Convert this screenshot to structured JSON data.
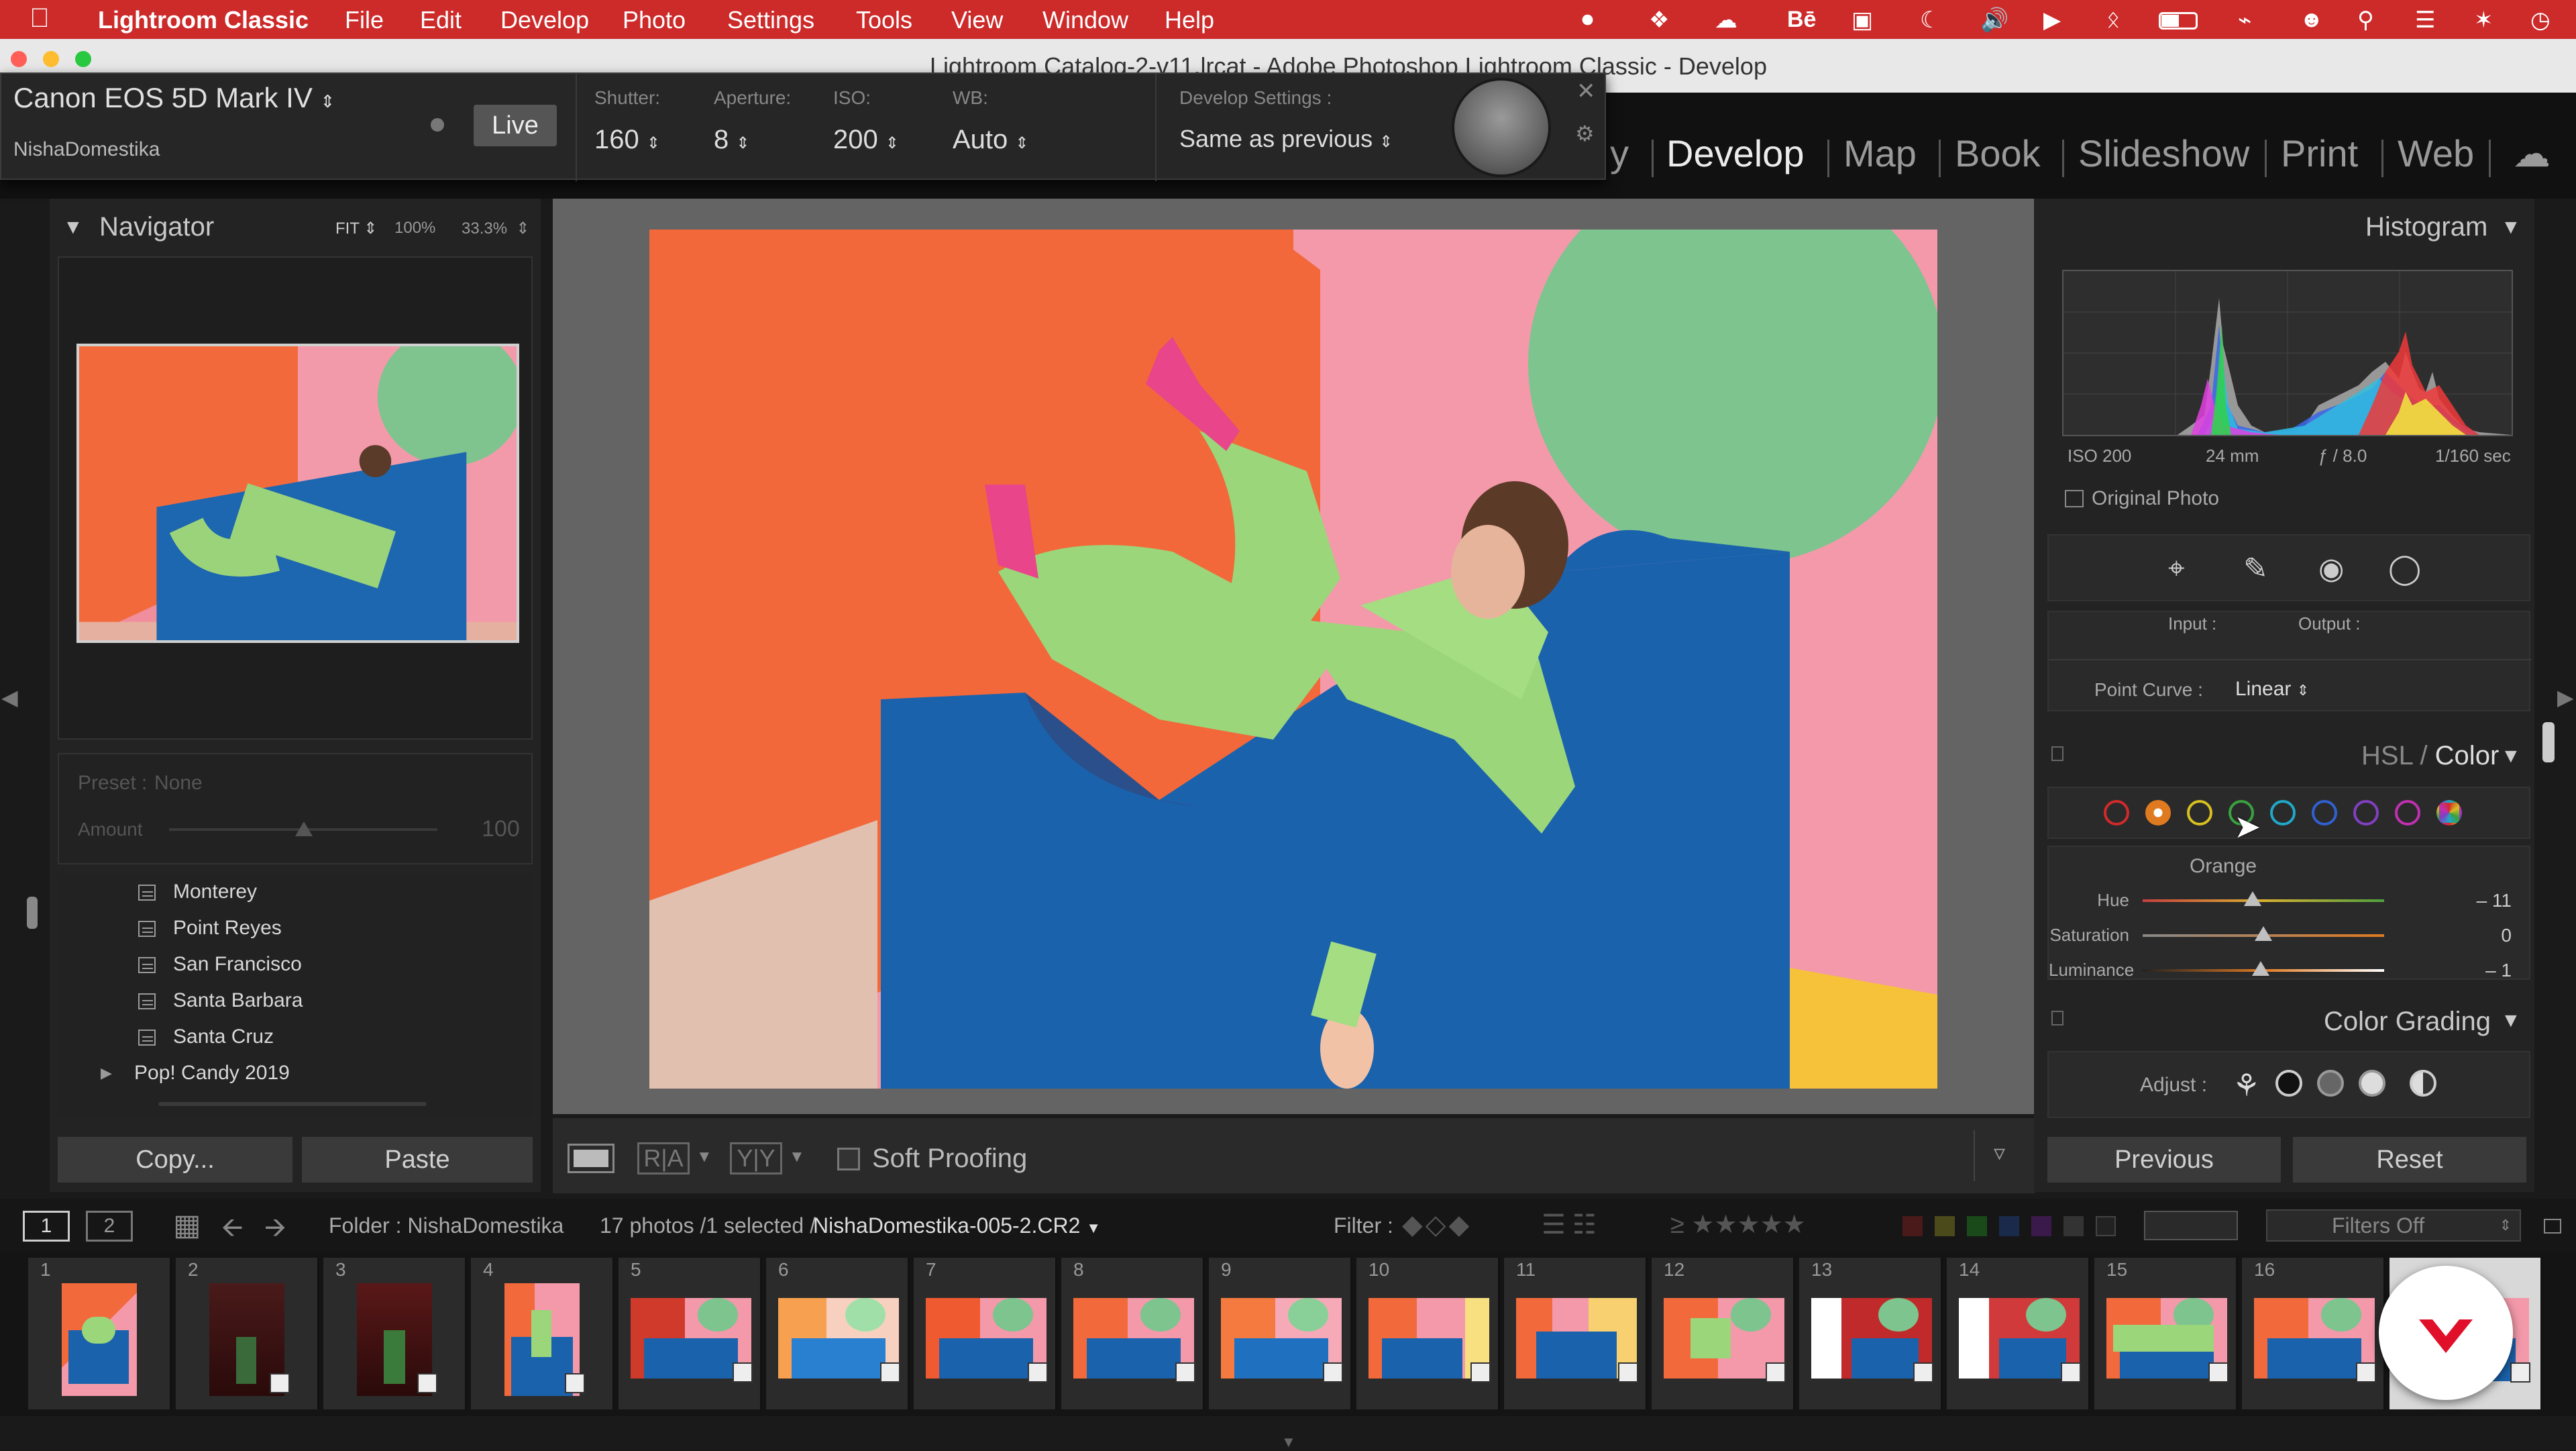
{
  "menubar": {
    "app": "Lightroom Classic",
    "items": [
      "File",
      "Edit",
      "Develop",
      "Photo",
      "Settings",
      "Tools",
      "View",
      "Window",
      "Help"
    ],
    "bg": "#cd2a2a"
  },
  "titlebar": {
    "title": "Lightroom Catalog-2-v11.lrcat - Adobe Photoshop Lightroom Classic - Develop"
  },
  "modules": {
    "items": [
      "y",
      "Develop",
      "Map",
      "Book",
      "Slideshow",
      "Print",
      "Web"
    ],
    "active": "Develop"
  },
  "tether": {
    "camera": "Canon EOS 5D Mark IV",
    "session": "NishaDomestika",
    "live": "Live",
    "shutter_label": "Shutter:",
    "shutter": "160",
    "aperture_label": "Aperture:",
    "aperture": "8",
    "iso_label": "ISO:",
    "iso": "200",
    "wb_label": "WB:",
    "wb": "Auto",
    "devsettings_label": "Develop Settings :",
    "devsettings": "Same as previous"
  },
  "navigator": {
    "title": "Navigator",
    "zoom": [
      "FIT",
      "100%",
      "33.3%"
    ]
  },
  "presetpanel": {
    "preset_label": "Preset :",
    "preset": "None",
    "amount_label": "Amount",
    "amount": "100"
  },
  "collections": {
    "items": [
      "Monterey",
      "Point Reyes",
      "San Francisco",
      "Santa Barbara",
      "Santa Cruz"
    ],
    "group": "Pop! Candy 2019"
  },
  "leftbuttons": {
    "copy": "Copy...",
    "paste": "Paste"
  },
  "toolbar": {
    "soft_proofing": "Soft Proofing"
  },
  "histogram": {
    "title": "Histogram",
    "iso": "ISO 200",
    "focal": "24 mm",
    "fstop": "ƒ / 8.0",
    "shutter": "1/160 sec",
    "original": "Original Photo"
  },
  "tonecurve": {
    "input": "Input :",
    "output": "Output :",
    "pointcurve_label": "Point Curve :",
    "pointcurve": "Linear"
  },
  "hsl": {
    "title_a": "HSL",
    "title_b": "Color",
    "selected": "Orange",
    "colors": [
      "#d02a2a",
      "#e07a20",
      "#d8c020",
      "#3aa040",
      "#20a8c8",
      "#3060d0",
      "#8040c0",
      "#c030b0"
    ],
    "sliders": [
      {
        "label": "Hue",
        "value": "– 11",
        "pos": 0.45
      },
      {
        "label": "Saturation",
        "value": "0",
        "pos": 0.5
      },
      {
        "label": "Luminance",
        "value": "– 1",
        "pos": 0.49
      }
    ]
  },
  "colorgrading": {
    "title": "Color Grading",
    "adjust": "Adjust :"
  },
  "rightbuttons": {
    "previous": "Previous",
    "reset": "Reset"
  },
  "filmstrip": {
    "page1": "1",
    "page2": "2",
    "folder": "Folder : NishaDomestika",
    "count": "17 photos /1 selected /",
    "file": "NishaDomestika-005-2.CR2",
    "filter_label": "Filter :",
    "filters_off": "Filters Off",
    "numbers": [
      "1",
      "2",
      "3",
      "4",
      "5",
      "6",
      "7",
      "8",
      "9",
      "10",
      "11",
      "12",
      "13",
      "14",
      "15",
      "16"
    ]
  }
}
